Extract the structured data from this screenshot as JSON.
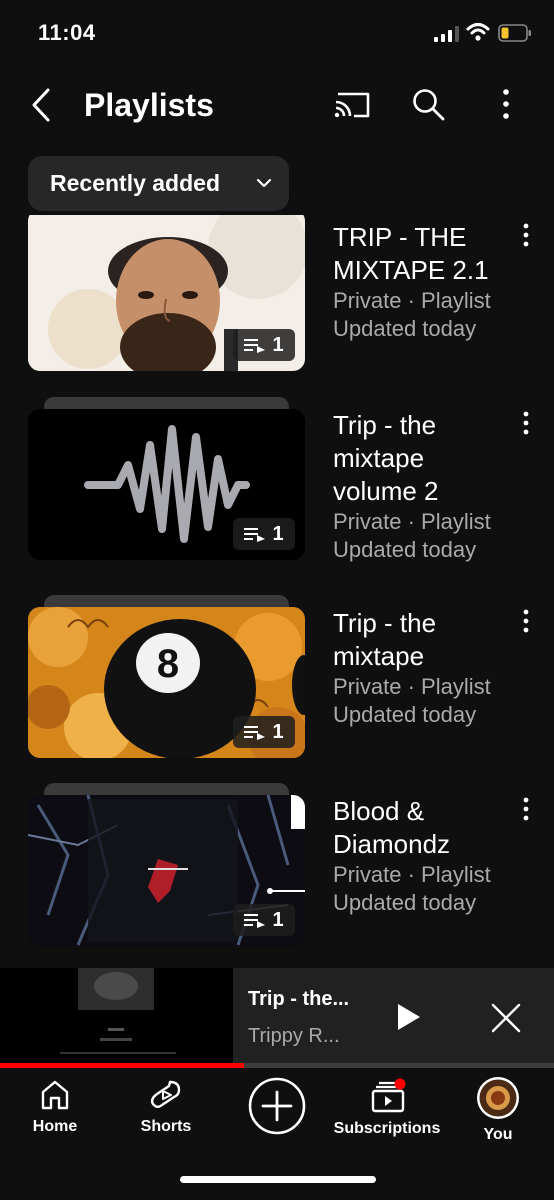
{
  "status_bar": {
    "time": "11:04"
  },
  "header": {
    "title": "Playlists"
  },
  "sort": {
    "label": "Recently added"
  },
  "playlists": [
    {
      "title_lines": [
        "TRIP - THE",
        "MIXTAPE 2.1"
      ],
      "meta": "Private · Playlist",
      "updated": "Updated today",
      "count": "1"
    },
    {
      "title_lines": [
        "Trip - the",
        "mixtape",
        "volume 2"
      ],
      "meta": "Private · Playlist",
      "updated": "Updated today",
      "count": "1"
    },
    {
      "title_lines": [
        "Trip - the",
        "mixtape"
      ],
      "meta": "Private · Playlist",
      "updated": "Updated today",
      "count": "1"
    },
    {
      "title_lines": [
        "Blood &",
        "Diamondz"
      ],
      "meta": "Private · Playlist",
      "updated": "Updated today",
      "count": "1"
    }
  ],
  "mini_player": {
    "title": "Trip - the...",
    "artist": "Trippy R...",
    "progress": 0.44
  },
  "nav": [
    {
      "label": "Home",
      "icon": "home-icon"
    },
    {
      "label": "Shorts",
      "icon": "shorts-icon"
    },
    {
      "label": "",
      "icon": "create-icon"
    },
    {
      "label": "Subscriptions",
      "icon": "subscriptions-icon"
    },
    {
      "label": "You",
      "icon": "avatar"
    }
  ],
  "colors": {
    "background": "#0f0f0f",
    "chip": "#272727",
    "secondary_text": "#aaaaaa",
    "accent": "#ff0000"
  }
}
